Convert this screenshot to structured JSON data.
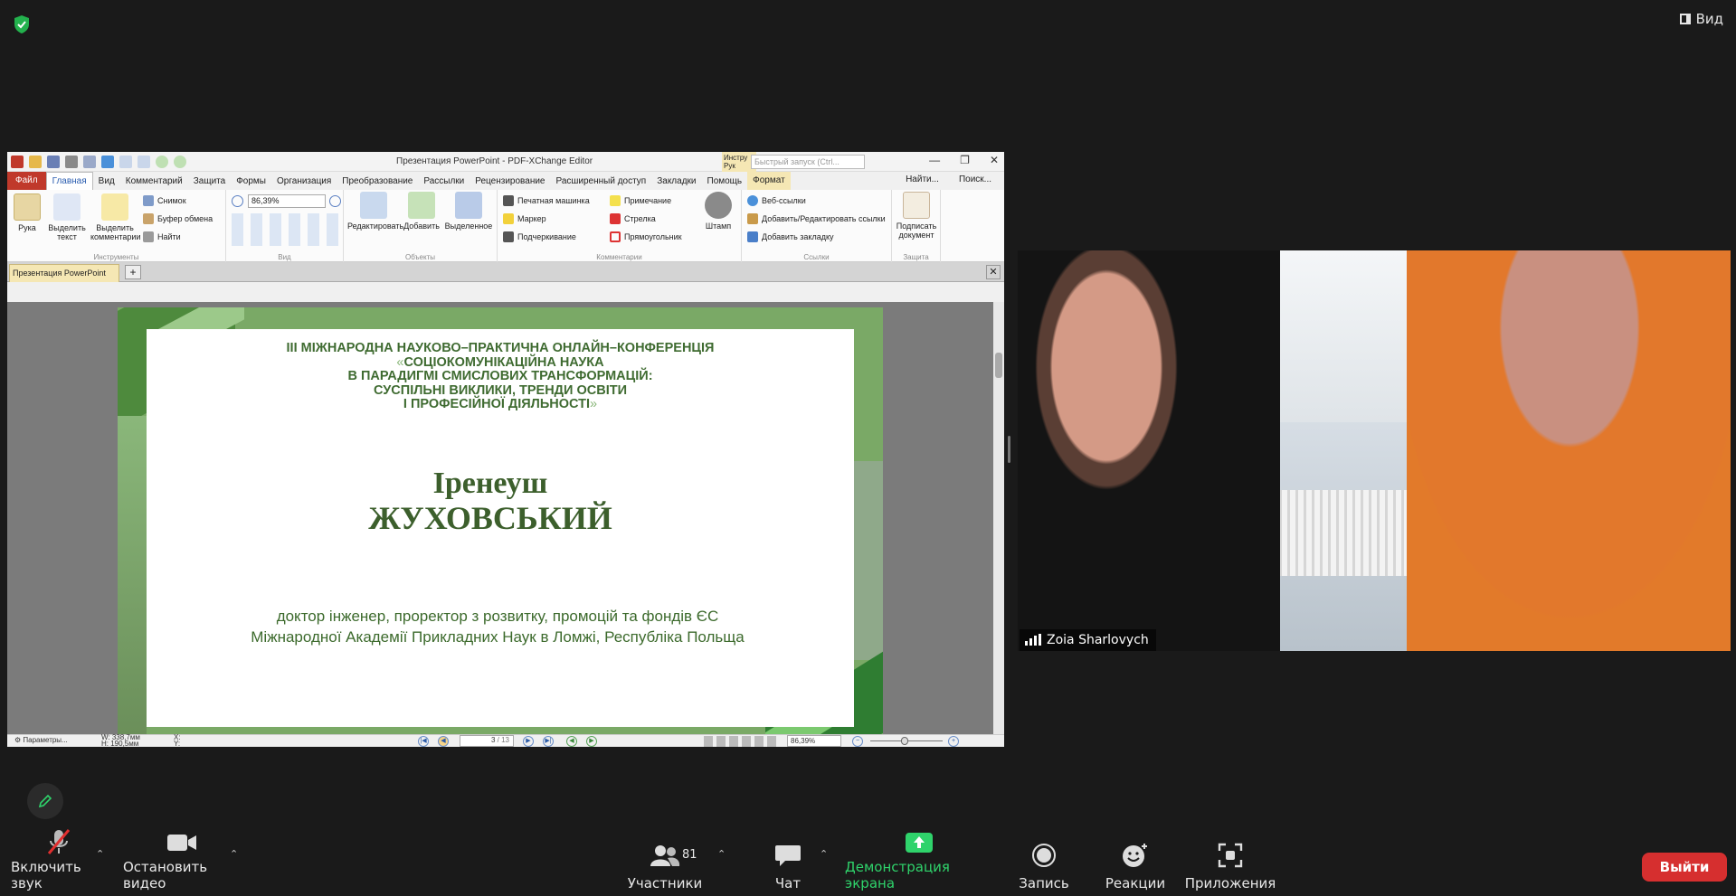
{
  "top": {
    "view_label": "Вид"
  },
  "pdf": {
    "title": "Презентация PowerPoint - PDF-XChange Editor",
    "ctx_tab": "Инстру Рук",
    "quick_search_placeholder": "Быстрый запуск (Ctrl...",
    "menu": {
      "file": "Файл",
      "items": [
        "Главная",
        "Вид",
        "Комментарий",
        "Защита",
        "Формы",
        "Организация",
        "Преобразование",
        "Рассылки",
        "Рецензирование",
        "Расширенный доступ",
        "Закладки",
        "Помощь"
      ],
      "format": "Формат",
      "find": "Найти...",
      "search": "Поиск..."
    },
    "ribbon": {
      "hand": "Рука",
      "select_text": "Выделить текст",
      "select_comments": "Выделить комментарии",
      "snapshot": "Снимок",
      "clipboard": "Буфер обмена",
      "find": "Найти",
      "group_tools": "Инструменты",
      "zoom": "86,39%",
      "group_view": "Вид",
      "edit": "Редактировать",
      "add": "Добавить",
      "selected": "Выделенное",
      "group_objects": "Объекты",
      "typewriter": "Печатная машинка",
      "note": "Примечание",
      "marker": "Маркер",
      "arrow": "Стрелка",
      "underline": "Подчеркивание",
      "rectangle": "Прямоугольник",
      "stamp": "Штамп",
      "group_comments": "Комментарии",
      "web_links": "Веб-ссылки",
      "add_edit_links": "Добавить/Редактировать ссылки",
      "add_bookmark": "Добавить закладку",
      "group_links": "Ссылки",
      "sign": "Подписать документ",
      "group_protection": "Защита"
    },
    "doc_tab": "Презентация PowerPoint",
    "slide": {
      "line1": "III МІЖНАРОДНА НАУКОВО–ПРАКТИЧНА ОНЛАЙН–КОНФЕРЕНЦІЯ",
      "line2_open": "«",
      "line2": "СОЦІОКОМУНІКАЦІЙНА НАУКА",
      "line3": "В ПАРАДИГМІ СМИСЛОВИХ ТРАНСФОРМАЦІЙ:",
      "line4": "СУСПІЛЬНІ ВИКЛИКИ, ТРЕНДИ ОСВІТИ",
      "line5": "І ПРОФЕСІЙНОЇ ДІЯЛЬНОСТІ",
      "line5_close": "»",
      "name_first": "Іренеуш",
      "name_last": "ЖУХОВСЬКИЙ",
      "desc1": "доктор інженер, проректор з розвитку, промоцій та фондів ЄС",
      "desc2": "Міжнародної Академії Прикладних Наук в Ломжі, Республіка Польща"
    },
    "status": {
      "params": "Параметры...",
      "w": "W: 338,7мм",
      "h": "H: 190,5мм",
      "x": "X:",
      "y": "Y:",
      "page": "3",
      "pages": "/ 13",
      "zoom": "86,39%"
    }
  },
  "video": {
    "participant_name": "Zoia Sharlovych"
  },
  "toolbar": {
    "unmute": "Включить звук",
    "stop_video": "Остановить видео",
    "participants": "Участники",
    "participants_count": "81",
    "chat": "Чат",
    "share": "Демонстрация экрана",
    "record": "Запись",
    "reactions": "Реакции",
    "apps": "Приложения",
    "leave": "Выйти"
  },
  "colors": {
    "share_green": "#2fd36b",
    "leave_red": "#d62f2f",
    "slide_green": "#3f6b31"
  }
}
